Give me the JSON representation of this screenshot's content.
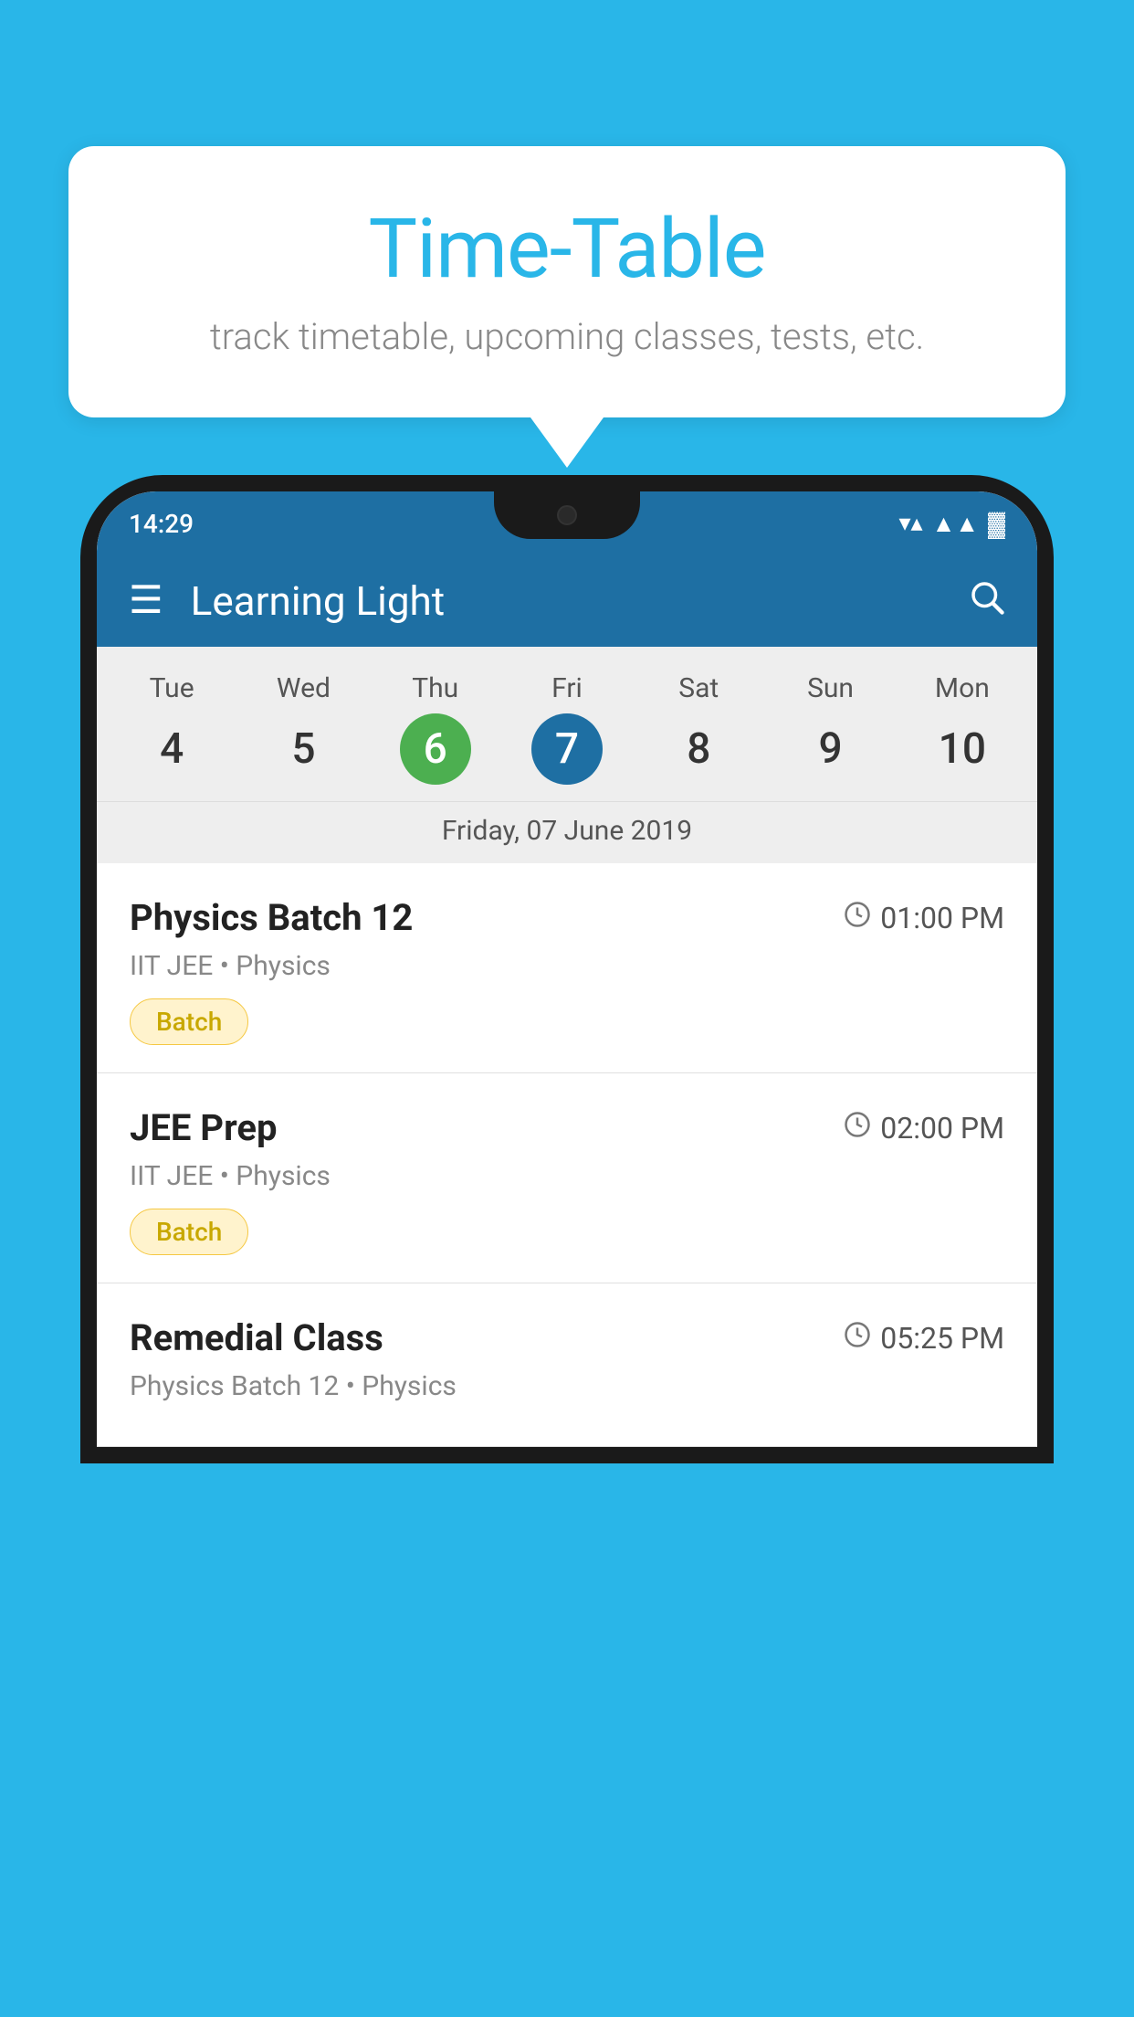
{
  "page": {
    "background_color": "#29B6E8"
  },
  "speech_bubble": {
    "title": "Time-Table",
    "subtitle": "track timetable, upcoming classes, tests, etc."
  },
  "phone": {
    "status_bar": {
      "time": "14:29",
      "icons": [
        "wifi",
        "signal",
        "battery"
      ]
    },
    "app_bar": {
      "title": "Learning Light",
      "menu_icon": "≡",
      "search_icon": "🔍"
    },
    "calendar": {
      "days": [
        {
          "label": "Tue",
          "number": "4",
          "state": "normal"
        },
        {
          "label": "Wed",
          "number": "5",
          "state": "normal"
        },
        {
          "label": "Thu",
          "number": "6",
          "state": "today"
        },
        {
          "label": "Fri",
          "number": "7",
          "state": "selected"
        },
        {
          "label": "Sat",
          "number": "8",
          "state": "normal"
        },
        {
          "label": "Sun",
          "number": "9",
          "state": "normal"
        },
        {
          "label": "Mon",
          "number": "10",
          "state": "normal"
        }
      ],
      "selected_date_label": "Friday, 07 June 2019"
    },
    "classes": [
      {
        "name": "Physics Batch 12",
        "time": "01:00 PM",
        "meta": "IIT JEE • Physics",
        "badge": "Batch"
      },
      {
        "name": "JEE Prep",
        "time": "02:00 PM",
        "meta": "IIT JEE • Physics",
        "badge": "Batch"
      },
      {
        "name": "Remedial Class",
        "time": "05:25 PM",
        "meta": "Physics Batch 12 • Physics",
        "badge": null
      }
    ]
  }
}
